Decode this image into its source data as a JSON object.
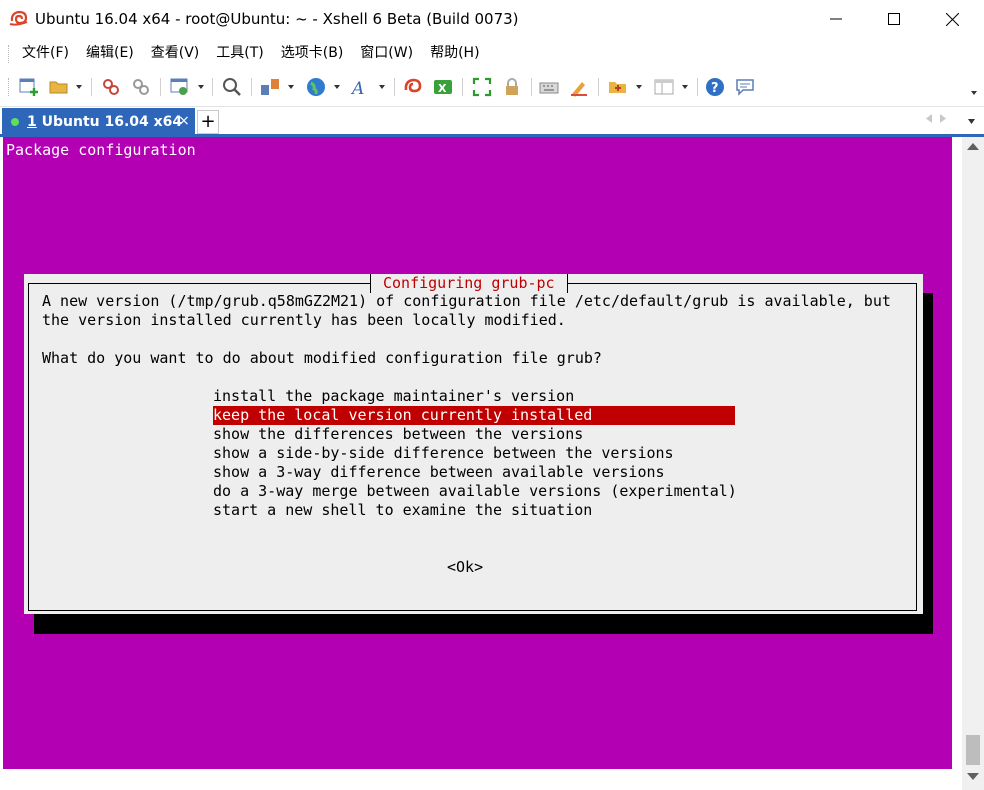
{
  "window": {
    "title": "Ubuntu 16.04 x64 - root@Ubuntu: ~ - Xshell 6 Beta (Build 0073)"
  },
  "menu": [
    "文件(F)",
    "编辑(E)",
    "查看(V)",
    "工具(T)",
    "选项卡(B)",
    "窗口(W)",
    "帮助(H)"
  ],
  "toolbar_icons": [
    "new-session-icon",
    "open-folder-icon",
    "reconnect-icon",
    "disconnect-icon",
    "properties-icon",
    "find-icon",
    "transfer-icon",
    "globe-icon",
    "font-icon",
    "xftp-icon",
    "xmanager-icon",
    "fullscreen-icon",
    "lock-icon",
    "keyboard-icon",
    "highlight-icon",
    "compose-icon",
    "layout-icon",
    "help-icon",
    "chat-icon"
  ],
  "tab": {
    "number": "1",
    "label": " Ubuntu 16.04 x64",
    "close": "×",
    "add": "+"
  },
  "terminal": {
    "header": "Package configuration",
    "dialog_title": "Configuring grub-pc",
    "message_line1": "A new version (/tmp/grub.q58mGZ2M21) of configuration file /etc/default/grub is available, but",
    "message_line2": "the version installed currently has been locally modified.",
    "question": "What do you want to do about modified configuration file grub?",
    "options": [
      "install the package maintainer's version",
      "keep the local version currently installed",
      "show the differences between the versions",
      "show a side-by-side difference between the versions",
      "show a 3-way difference between available versions",
      "do a 3-way merge between available versions (experimental)",
      "start a new shell to examine the situation"
    ],
    "selected_index": 1,
    "ok": "<Ok>"
  },
  "colors": {
    "terminal_bg": "#b300b3",
    "dialog_bg": "#eeeeee",
    "highlight": "#c00000",
    "tab_active": "#2e66b9"
  }
}
